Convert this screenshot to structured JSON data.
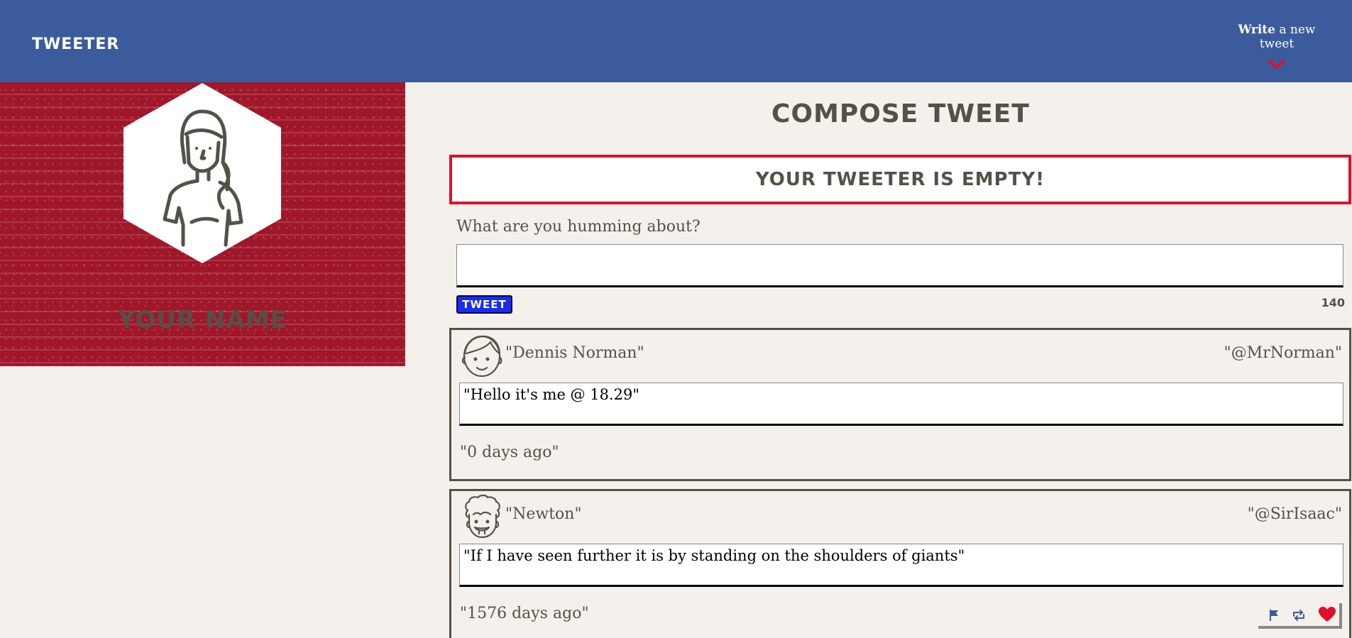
{
  "nav": {
    "logo": "TWEETER",
    "write_bold": "Write",
    "write_rest": " a new tweet"
  },
  "profile": {
    "name": "YOUR NAME"
  },
  "compose": {
    "title": "COMPOSE TWEET",
    "error": "YOUR TWEETER IS EMPTY!",
    "label": "What are you humming about?",
    "input_value": "",
    "button": "TWEET",
    "counter": "140"
  },
  "tweets": [
    {
      "name": "\"Dennis Norman\"",
      "handle": "\"@MrNorman\"",
      "content": "\"Hello it's me @ 18.29\"",
      "date": "\"0 days ago\""
    },
    {
      "name": "\"Newton\"",
      "handle": "\"@SirIsaac\"",
      "content": "\"If I have seen further it is by standing on the shoulders of giants\"",
      "date": "\"1576 days ago\""
    }
  ],
  "icons": {
    "flag": "flag-icon",
    "retweet": "retweet-icon",
    "heart": "heart-icon"
  },
  "colors": {
    "nav": "#3b5b9d",
    "profile_bg": "#a0172a",
    "error_border": "#e0102c",
    "tweet_button": "#1a2cf0",
    "heart": "#e0102c",
    "text": "#545149"
  }
}
